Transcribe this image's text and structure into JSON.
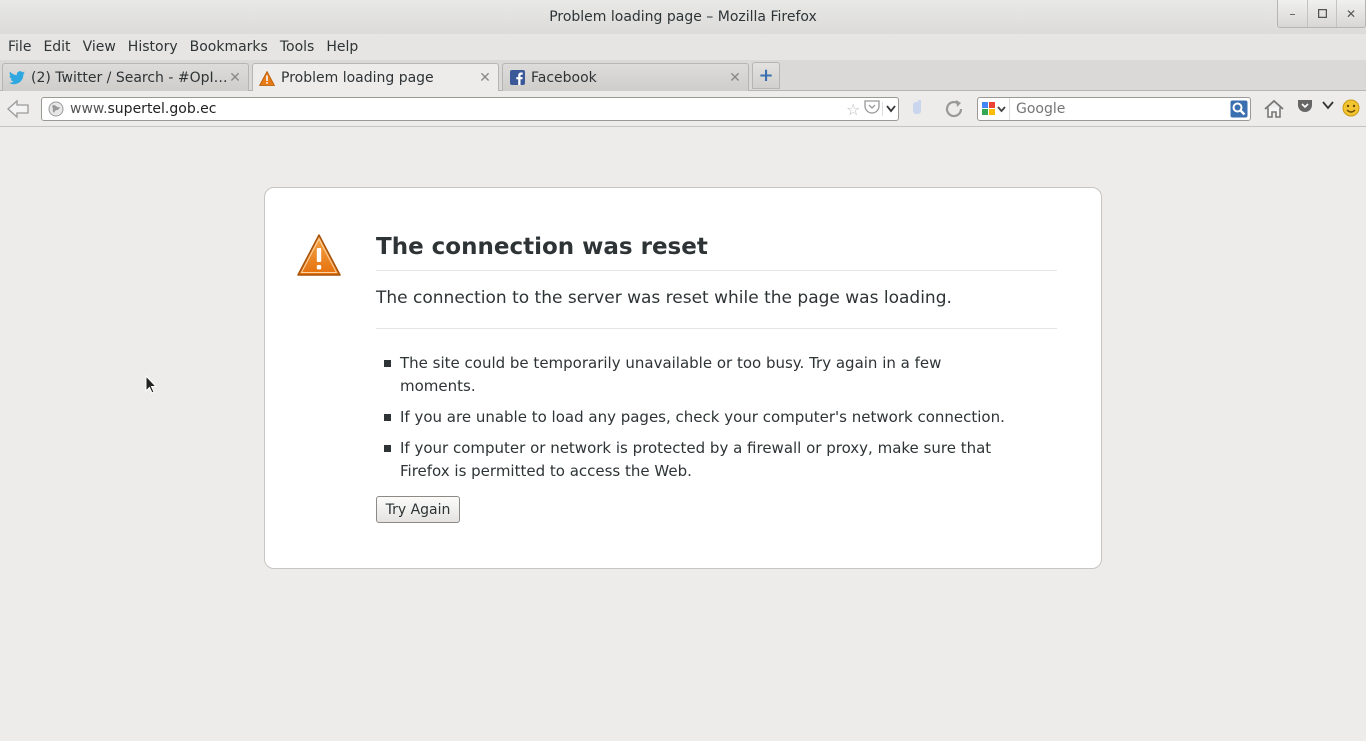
{
  "window": {
    "title": "Problem loading page – Mozilla Firefox",
    "controls": [
      "minimize-icon",
      "maximize-icon",
      "close-icon"
    ]
  },
  "menubar": {
    "items": [
      {
        "label": "File",
        "underline": "F"
      },
      {
        "label": "Edit",
        "underline": "E"
      },
      {
        "label": "View",
        "underline": "V"
      },
      {
        "label": "History",
        "underline": "s"
      },
      {
        "label": "Bookmarks",
        "underline": "B"
      },
      {
        "label": "Tools",
        "underline": "T"
      },
      {
        "label": "Help",
        "underline": "H"
      }
    ]
  },
  "tabs": [
    {
      "label": "(2) Twitter / Search - #OpIn...",
      "icon": "twitter-icon",
      "active": false
    },
    {
      "label": "Problem loading page",
      "icon": "warning-icon",
      "active": true
    },
    {
      "label": "Facebook",
      "icon": "facebook-icon",
      "active": false
    }
  ],
  "navbar": {
    "url_prefix": "www.",
    "url_domain": "supertel.gob.ec",
    "search_placeholder": "Google"
  },
  "error": {
    "title": "The connection was reset",
    "description": "The connection to the server was reset while the page was loading.",
    "suggestions": [
      "The site could be temporarily unavailable or too busy. Try again in a few moments.",
      "If you are unable to load any pages, check your computer's network connection.",
      "If your computer or network is protected by a firewall or proxy, make sure that Firefox is permitted to access the Web."
    ],
    "button_label": "Try Again"
  },
  "colors": {
    "warning_orange": "#e87a13",
    "twitter_blue": "#2fa7e0",
    "facebook_blue": "#3b5998",
    "accent_blue": "#3a6fb0"
  }
}
